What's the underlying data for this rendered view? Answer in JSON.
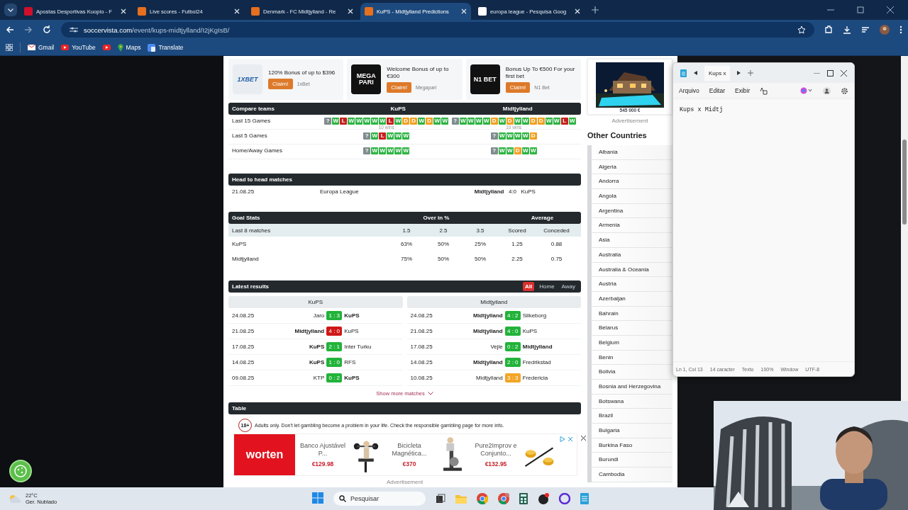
{
  "browser": {
    "tabs": [
      {
        "title": "Apostas Desportivas Kuopio - F",
        "selected": false
      },
      {
        "title": "Live scores - Futbol24",
        "selected": false
      },
      {
        "title": "Denmark - FC Midtjylland - Re",
        "selected": false
      },
      {
        "title": "KuPS - Midtjylland Predictions",
        "selected": true
      },
      {
        "title": "europa league - Pesquisa Goog",
        "selected": false
      }
    ],
    "url_host": "soccervista.com",
    "url_path": "/event/kups-midtjylland/I2jKgIsB/",
    "bookmarks": [
      {
        "label": "Gmail",
        "kind": "mail"
      },
      {
        "label": "YouTube",
        "kind": "video"
      },
      {
        "label": "Maps",
        "kind": "map"
      },
      {
        "label": "Translate",
        "kind": "translate"
      }
    ]
  },
  "promos": [
    {
      "logo": "1XBET",
      "kind": "light",
      "headline": "120% Bonus of up to $396",
      "button": "Claim!",
      "brand": "1xBet"
    },
    {
      "logo": "MEGA PARI",
      "kind": "dark",
      "headline": "Welcome Bonus of up to €300",
      "button": "Claim!",
      "brand": "Megapari"
    },
    {
      "logo": "N1 BET",
      "kind": "dark",
      "headline": "Bonus Up To €500 For your first bet",
      "button": "Claim!",
      "brand": "N1 Bet"
    }
  ],
  "side_ad": {
    "price": "545 000 €",
    "label": "Advertisement"
  },
  "compare": {
    "title": "Compare teams",
    "teams": [
      "KuPS",
      "Midtjylland"
    ],
    "rows": [
      {
        "label": "Last 15 Games",
        "captions": [
          "10 wins",
          "10 wins"
        ],
        "forms": [
          [
            {
              "label": "?",
              "kind": "none"
            },
            {
              "label": "W",
              "kind": "win"
            },
            {
              "label": "L",
              "kind": "loss"
            },
            {
              "label": "W",
              "kind": "win"
            },
            {
              "label": "W",
              "kind": "win"
            },
            {
              "label": "W",
              "kind": "win"
            },
            {
              "label": "W",
              "kind": "win"
            },
            {
              "label": "W",
              "kind": "win"
            },
            {
              "label": "L",
              "kind": "loss"
            },
            {
              "label": "W",
              "kind": "win"
            },
            {
              "label": "D",
              "kind": "draw"
            },
            {
              "label": "D",
              "kind": "draw"
            },
            {
              "label": "W",
              "kind": "win"
            },
            {
              "label": "D",
              "kind": "draw"
            },
            {
              "label": "W",
              "kind": "win"
            },
            {
              "label": "W",
              "kind": "win"
            }
          ],
          [
            {
              "label": "?",
              "kind": "none"
            },
            {
              "label": "W",
              "kind": "win"
            },
            {
              "label": "W",
              "kind": "win"
            },
            {
              "label": "W",
              "kind": "win"
            },
            {
              "label": "W",
              "kind": "win"
            },
            {
              "label": "D",
              "kind": "draw"
            },
            {
              "label": "W",
              "kind": "win"
            },
            {
              "label": "D",
              "kind": "draw"
            },
            {
              "label": "W",
              "kind": "win"
            },
            {
              "label": "W",
              "kind": "win"
            },
            {
              "label": "D",
              "kind": "draw"
            },
            {
              "label": "D",
              "kind": "draw"
            },
            {
              "label": "W",
              "kind": "win"
            },
            {
              "label": "W",
              "kind": "win"
            },
            {
              "label": "L",
              "kind": "loss"
            },
            {
              "label": "W",
              "kind": "win"
            }
          ]
        ]
      },
      {
        "label": "Last 5 Games",
        "forms": [
          [
            {
              "label": "?",
              "kind": "none"
            },
            {
              "label": "W",
              "kind": "win"
            },
            {
              "label": "L",
              "kind": "loss"
            },
            {
              "label": "W",
              "kind": "win"
            },
            {
              "label": "W",
              "kind": "win"
            },
            {
              "label": "W",
              "kind": "win"
            }
          ],
          [
            {
              "label": "?",
              "kind": "none"
            },
            {
              "label": "W",
              "kind": "win"
            },
            {
              "label": "W",
              "kind": "win"
            },
            {
              "label": "W",
              "kind": "win"
            },
            {
              "label": "W",
              "kind": "win"
            },
            {
              "label": "D",
              "kind": "draw"
            }
          ]
        ]
      },
      {
        "label": "Home/Away Games",
        "forms": [
          [
            {
              "label": "?",
              "kind": "none"
            },
            {
              "label": "W",
              "kind": "win"
            },
            {
              "label": "W",
              "kind": "win"
            },
            {
              "label": "W",
              "kind": "win"
            },
            {
              "label": "W",
              "kind": "win"
            },
            {
              "label": "W",
              "kind": "win"
            }
          ],
          [
            {
              "label": "?",
              "kind": "none"
            },
            {
              "label": "W",
              "kind": "win"
            },
            {
              "label": "W",
              "kind": "win"
            },
            {
              "label": "D",
              "kind": "draw"
            },
            {
              "label": "W",
              "kind": "win"
            },
            {
              "label": "W",
              "kind": "win"
            }
          ]
        ]
      }
    ]
  },
  "h2h": {
    "title": "Head to head matches",
    "matches": [
      {
        "date": "21.08.25",
        "competition": "Europa League",
        "home": "Midtjylland",
        "score": "4:0",
        "away": "KuPS"
      }
    ]
  },
  "goal_stats": {
    "title": "Goal Stats",
    "group_headers": [
      "Over in %",
      "Average"
    ],
    "columns": [
      "Last 8 matches",
      "1.5",
      "2.5",
      "3.5",
      "Scored",
      "Conceded"
    ],
    "rows": [
      {
        "team": "KuPS",
        "values": [
          "63%",
          "50%",
          "25%",
          "1.25",
          "0.88"
        ]
      },
      {
        "team": "Midtjylland",
        "values": [
          "75%",
          "50%",
          "50%",
          "2.25",
          "0.75"
        ]
      }
    ]
  },
  "latest": {
    "title": "Latest results",
    "filters": [
      {
        "label": "All",
        "selected": true
      },
      {
        "label": "Home",
        "selected": false
      },
      {
        "label": "Away",
        "selected": false
      }
    ],
    "teams": [
      {
        "name": "KuPS",
        "results": [
          {
            "date": "24.08.25",
            "home": "Jaro",
            "score": "1 : 3",
            "away": "KuPS",
            "kind": "win",
            "home_bold": false,
            "away_bold": true
          },
          {
            "date": "21.08.25",
            "home": "Midtjylland",
            "score": "4 : 0",
            "away": "KuPS",
            "kind": "loss",
            "home_bold": true,
            "away_bold": false
          },
          {
            "date": "17.08.25",
            "home": "KuPS",
            "score": "2 : 1",
            "away": "Inter Turku",
            "kind": "win",
            "home_bold": true,
            "away_bold": false
          },
          {
            "date": "14.08.25",
            "home": "KuPS",
            "score": "1 : 0",
            "away": "RFS",
            "kind": "win",
            "home_bold": true,
            "away_bold": false
          },
          {
            "date": "09.08.25",
            "home": "KTP",
            "score": "0 : 2",
            "away": "KuPS",
            "kind": "win",
            "home_bold": false,
            "away_bold": true
          }
        ]
      },
      {
        "name": "Midtjylland",
        "results": [
          {
            "date": "24.08.25",
            "home": "Midtjylland",
            "score": "4 : 2",
            "away": "Silkeborg",
            "kind": "win",
            "home_bold": true,
            "away_bold": false
          },
          {
            "date": "21.08.25",
            "home": "Midtjylland",
            "score": "4 : 0",
            "away": "KuPS",
            "kind": "win",
            "home_bold": true,
            "away_bold": false
          },
          {
            "date": "17.08.25",
            "home": "Vejle",
            "score": "0 : 2",
            "away": "Midtjylland",
            "kind": "win",
            "home_bold": false,
            "away_bold": true
          },
          {
            "date": "14.08.25",
            "home": "Midtjylland",
            "score": "2 : 0",
            "away": "Fredrikstad",
            "kind": "win",
            "home_bold": true,
            "away_bold": false
          },
          {
            "date": "10.08.25",
            "home": "Midtjylland",
            "score": "3 : 3",
            "away": "Fredericia",
            "kind": "draw",
            "home_bold": false,
            "away_bold": false
          }
        ]
      }
    ],
    "more": "Show more matches"
  },
  "table": {
    "title": "Table"
  },
  "notice": {
    "badge": "18+",
    "text": "Adults only. Don't let gambling become a problem in your life. Check the responsible gambling page for more info."
  },
  "sidebar": {
    "title": "Other Countries",
    "countries": [
      "Albania",
      "Algeria",
      "Andorra",
      "Angola",
      "Argentina",
      "Armenia",
      "Asia",
      "Australia",
      "Australia & Oceania",
      "Austria",
      "Azerbaijan",
      "Bahrain",
      "Belarus",
      "Belgium",
      "Benin",
      "Bolivia",
      "Bosnia and Herzegovina",
      "Botswana",
      "Brazil",
      "Bulgaria",
      "Burkina Faso",
      "Burundi",
      "Cambodia"
    ]
  },
  "bottom_ad": {
    "brand": "worten",
    "products": [
      {
        "name": "Banco Ajustável P...",
        "price": "€129.98"
      },
      {
        "name": "Bicicleta Magnética...",
        "price": "€370"
      },
      {
        "name": "Pure2Improv e Conjunto...",
        "price": "€132.95"
      }
    ],
    "label": "Advertisement"
  },
  "notepad": {
    "tab": "Kups x",
    "menus": [
      "Arquivo",
      "Editar",
      "Exibir"
    ],
    "text": "Kups x Midtj",
    "status": [
      "Ln 1, Col 13",
      "14 caracter",
      "Texto",
      "100%",
      "Window",
      "UTF-8"
    ]
  },
  "taskbar": {
    "temperature": "22°C",
    "weather": "Ger. Nublado",
    "search_placeholder": "Pesquisar"
  }
}
